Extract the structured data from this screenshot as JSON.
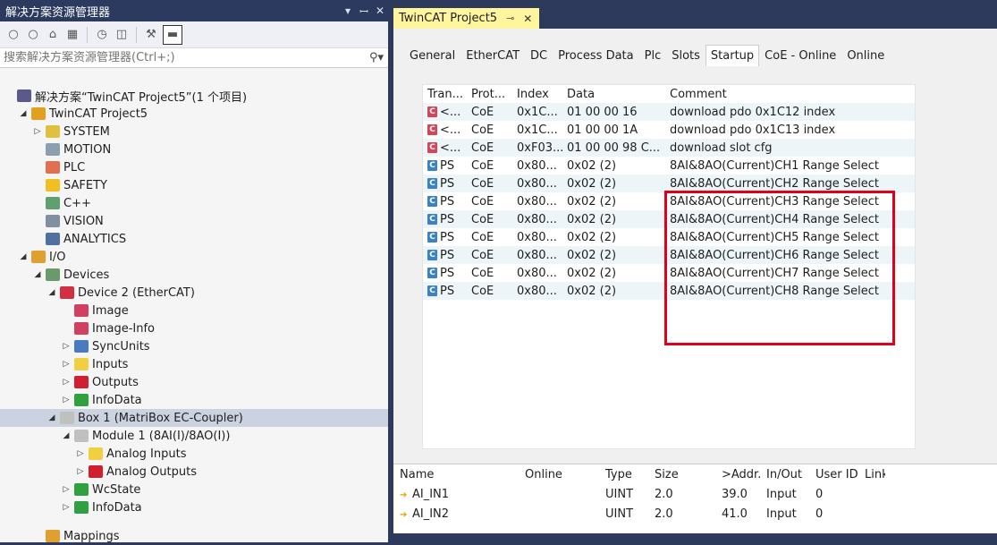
{
  "solution_explorer": {
    "title": "解决方案资源管理器",
    "title_controls": [
      "▾",
      "ꟷ",
      "✕"
    ],
    "search": {
      "placeholder": "搜索解决方案资源管理器(Ctrl+;)"
    },
    "tree": [
      {
        "label": "解决方案“TwinCAT Project5”(1 个项目)",
        "depth": 0,
        "twisty": "",
        "icon": "solution-icon",
        "color": "#5a5a8a"
      },
      {
        "label": "TwinCAT Project5",
        "depth": 1,
        "twisty": "◢",
        "icon": "project-icon",
        "color": "#e0a020"
      },
      {
        "label": "SYSTEM",
        "depth": 2,
        "twisty": "▷",
        "icon": "system-icon",
        "color": "#e0c040"
      },
      {
        "label": "MOTION",
        "depth": 2,
        "twisty": "",
        "icon": "motion-icon",
        "color": "#8aa0b0"
      },
      {
        "label": "PLC",
        "depth": 2,
        "twisty": "",
        "icon": "plc-icon",
        "color": "#e07050"
      },
      {
        "label": "SAFETY",
        "depth": 2,
        "twisty": "",
        "icon": "safety-icon",
        "color": "#f0c020"
      },
      {
        "label": "C++",
        "depth": 2,
        "twisty": "",
        "icon": "cpp-icon",
        "color": "#60a070"
      },
      {
        "label": "VISION",
        "depth": 2,
        "twisty": "",
        "icon": "vision-icon",
        "color": "#8090a0"
      },
      {
        "label": "ANALYTICS",
        "depth": 2,
        "twisty": "",
        "icon": "analytics-icon",
        "color": "#5070a0"
      },
      {
        "label": "I/O",
        "depth": 1,
        "twisty": "◢",
        "icon": "io-icon",
        "color": "#e0a030"
      },
      {
        "label": "Devices",
        "depth": 2,
        "twisty": "◢",
        "icon": "devices-icon",
        "color": "#6a9a6a"
      },
      {
        "label": "Device 2 (EtherCAT)",
        "depth": 3,
        "twisty": "◢",
        "icon": "ethercat-device-icon",
        "color": "#d03040"
      },
      {
        "label": "Image",
        "depth": 4,
        "twisty": "",
        "icon": "image-icon",
        "color": "#d04060"
      },
      {
        "label": "Image-Info",
        "depth": 4,
        "twisty": "",
        "icon": "image-info-icon",
        "color": "#d04060"
      },
      {
        "label": "SyncUnits",
        "depth": 4,
        "twisty": "▷",
        "icon": "syncunits-icon",
        "color": "#4a7ac0"
      },
      {
        "label": "Inputs",
        "depth": 4,
        "twisty": "▷",
        "icon": "inputs-icon",
        "color": "#f0d040"
      },
      {
        "label": "Outputs",
        "depth": 4,
        "twisty": "▷",
        "icon": "outputs-icon",
        "color": "#d02030"
      },
      {
        "label": "InfoData",
        "depth": 4,
        "twisty": "▷",
        "icon": "infodata-icon",
        "color": "#30a040"
      },
      {
        "label": "Box 1 (MatriBox EC-Coupler)",
        "depth": 3,
        "twisty": "◢",
        "icon": "box-icon",
        "color": "#c0c0c0",
        "selected": true
      },
      {
        "label": "Module 1 (8AI(I)/8AO(I))",
        "depth": 4,
        "twisty": "◢",
        "icon": "module-icon",
        "color": "#c0c0c0"
      },
      {
        "label": "Analog Inputs",
        "depth": 5,
        "twisty": "▷",
        "icon": "analog-inputs-icon",
        "color": "#f0d040"
      },
      {
        "label": "Analog Outputs",
        "depth": 5,
        "twisty": "▷",
        "icon": "analog-outputs-icon",
        "color": "#d02030"
      },
      {
        "label": "WcState",
        "depth": 4,
        "twisty": "▷",
        "icon": "wcstate-icon",
        "color": "#30a040"
      },
      {
        "label": "InfoData",
        "depth": 4,
        "twisty": "▷",
        "icon": "infodata-icon",
        "color": "#30a040"
      },
      {
        "label": "",
        "depth": 0,
        "twisty": "",
        "icon": "",
        "color": "",
        "spacer": true
      },
      {
        "label": "Mappings",
        "depth": 2,
        "twisty": "",
        "icon": "mappings-icon",
        "color": "#e0a030"
      }
    ]
  },
  "document": {
    "tab_label": "TwinCAT Project5",
    "pin_glyph": "⊸",
    "close_glyph": "✕",
    "subtabs": [
      "General",
      "EtherCAT",
      "DC",
      "Process Data",
      "Plc",
      "Slots",
      "Startup",
      "CoE - Online",
      "Online"
    ],
    "active_subtab": "Startup",
    "startup": {
      "headers": [
        "Tran...",
        "Prot...",
        "Index",
        "Data",
        "Comment"
      ],
      "rows": [
        {
          "badge": "C",
          "tran": "<...",
          "prot": "CoE",
          "index": "0x1C...",
          "data": "01 00 00 16",
          "comment": "download pdo 0x1C12 index"
        },
        {
          "badge": "C",
          "tran": "<...",
          "prot": "CoE",
          "index": "0x1C...",
          "data": "01 00 00 1A",
          "comment": "download pdo 0x1C13 index"
        },
        {
          "badge": "C",
          "tran": "<...",
          "prot": "CoE",
          "index": "0xF03...",
          "data": "01 00 00 98 C...",
          "comment": "download slot cfg"
        },
        {
          "badge": "C",
          "tran": "PS",
          "prot": "CoE",
          "index": "0x80...",
          "data": "0x02 (2)",
          "comment": "8AI&8AO(Current)CH1 Range Select"
        },
        {
          "badge": "C",
          "tran": "PS",
          "prot": "CoE",
          "index": "0x80...",
          "data": "0x02 (2)",
          "comment": "8AI&8AO(Current)CH2 Range Select"
        },
        {
          "badge": "C",
          "tran": "PS",
          "prot": "CoE",
          "index": "0x80...",
          "data": "0x02 (2)",
          "comment": "8AI&8AO(Current)CH3 Range Select"
        },
        {
          "badge": "C",
          "tran": "PS",
          "prot": "CoE",
          "index": "0x80...",
          "data": "0x02 (2)",
          "comment": "8AI&8AO(Current)CH4 Range Select"
        },
        {
          "badge": "C",
          "tran": "PS",
          "prot": "CoE",
          "index": "0x80...",
          "data": "0x02 (2)",
          "comment": "8AI&8AO(Current)CH5 Range Select"
        },
        {
          "badge": "C",
          "tran": "PS",
          "prot": "CoE",
          "index": "0x80...",
          "data": "0x02 (2)",
          "comment": "8AI&8AO(Current)CH6 Range Select"
        },
        {
          "badge": "C",
          "tran": "PS",
          "prot": "CoE",
          "index": "0x80...",
          "data": "0x02 (2)",
          "comment": "8AI&8AO(Current)CH7 Range Select"
        },
        {
          "badge": "C",
          "tran": "PS",
          "prot": "CoE",
          "index": "0x80...",
          "data": "0x02 (2)",
          "comment": "8AI&8AO(Current)CH8 Range Select"
        }
      ]
    },
    "variables": {
      "headers": [
        "Name",
        "",
        "Online",
        "Type",
        "Size",
        ">Addr...",
        "In/Out",
        "User ID",
        "Link"
      ],
      "rows": [
        {
          "name": "AI_IN1",
          "online": "",
          "type": "UINT",
          "size": "2.0",
          "addr": "39.0",
          "inout": "Input",
          "userid": "0",
          "link": ""
        },
        {
          "name": "AI_IN2",
          "online": "",
          "type": "UINT",
          "size": "2.0",
          "addr": "41.0",
          "inout": "Input",
          "userid": "0",
          "link": ""
        }
      ]
    }
  },
  "colors": {
    "title_bar": "#2b3a5e",
    "doc_tab": "#fff59d",
    "highlight": "#e0001b",
    "badge_c": "#d64556",
    "badge_p": "#3a82c8"
  }
}
